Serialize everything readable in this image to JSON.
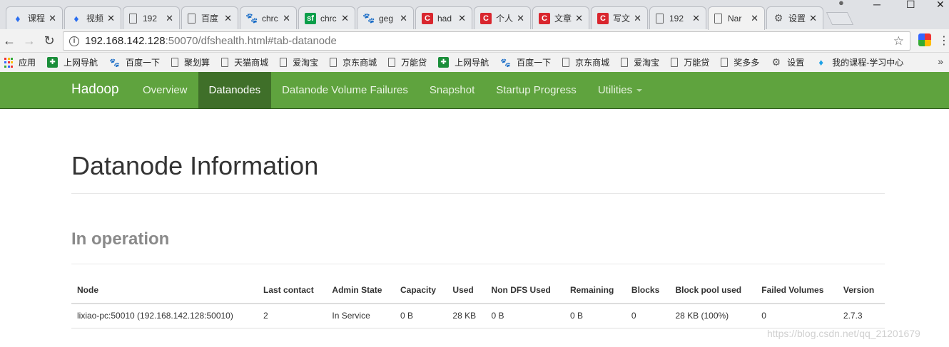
{
  "browser": {
    "tabs": [
      {
        "title": "课程",
        "icon": "course-icon"
      },
      {
        "title": "视频",
        "icon": "course-icon"
      },
      {
        "title": "192",
        "icon": "doc-icon"
      },
      {
        "title": "百度",
        "icon": "doc-icon"
      },
      {
        "title": "chrc",
        "icon": "baidu-icon"
      },
      {
        "title": "chrc",
        "icon": "sf-icon"
      },
      {
        "title": "geg",
        "icon": "baidu-icon"
      },
      {
        "title": "had",
        "icon": "csdn-icon"
      },
      {
        "title": "个人",
        "icon": "csdn-icon"
      },
      {
        "title": "文章",
        "icon": "csdn-icon"
      },
      {
        "title": "写文",
        "icon": "csdn-icon"
      },
      {
        "title": "192",
        "icon": "doc-icon"
      },
      {
        "title": "Nar",
        "icon": "doc-icon",
        "active": true
      },
      {
        "title": "设置",
        "icon": "gear-icon"
      }
    ],
    "close_glyph": "✕",
    "address": {
      "host": "192.168.142.128",
      "path": ":50070/dfshealth.html#tab-datanode"
    },
    "bookmarks": [
      {
        "label": "应用",
        "icon": "apps-icon"
      },
      {
        "label": "上网导航",
        "icon": "nav-icon"
      },
      {
        "label": "百度一下",
        "icon": "baidu-icon"
      },
      {
        "label": "聚划算",
        "icon": "doc-icon"
      },
      {
        "label": "天猫商城",
        "icon": "doc-icon"
      },
      {
        "label": "爱淘宝",
        "icon": "doc-icon"
      },
      {
        "label": "京东商城",
        "icon": "doc-icon"
      },
      {
        "label": "万能贷",
        "icon": "doc-icon"
      },
      {
        "label": "上网导航",
        "icon": "nav-icon"
      },
      {
        "label": "百度一下",
        "icon": "baidu-icon"
      },
      {
        "label": "京东商城",
        "icon": "doc-icon"
      },
      {
        "label": "爱淘宝",
        "icon": "doc-icon"
      },
      {
        "label": "万能贷",
        "icon": "doc-icon"
      },
      {
        "label": "奖多多",
        "icon": "doc-icon"
      },
      {
        "label": "设置",
        "icon": "gear-icon"
      },
      {
        "label": "我的课程-学习中心",
        "icon": "course-icon"
      }
    ]
  },
  "navbar": {
    "brand": "Hadoop",
    "links": [
      "Overview",
      "Datanodes",
      "Datanode Volume Failures",
      "Snapshot",
      "Startup Progress",
      "Utilities"
    ],
    "active": "Datanodes"
  },
  "page": {
    "title": "Datanode Information",
    "section": "In operation"
  },
  "table": {
    "headers": [
      "Node",
      "Last contact",
      "Admin State",
      "Capacity",
      "Used",
      "Non DFS Used",
      "Remaining",
      "Blocks",
      "Block pool used",
      "Failed Volumes",
      "Version"
    ],
    "rows": [
      [
        "lixiao-pc:50010 (192.168.142.128:50010)",
        "2",
        "In Service",
        "0 B",
        "28 KB",
        "0 B",
        "0 B",
        "0",
        "28 KB (100%)",
        "0",
        "2.7.3"
      ]
    ]
  },
  "watermark": "https://blog.csdn.net/qq_21201679",
  "colors": {
    "navbar": "#5fa33e",
    "navbar_active": "#3f6f29"
  }
}
